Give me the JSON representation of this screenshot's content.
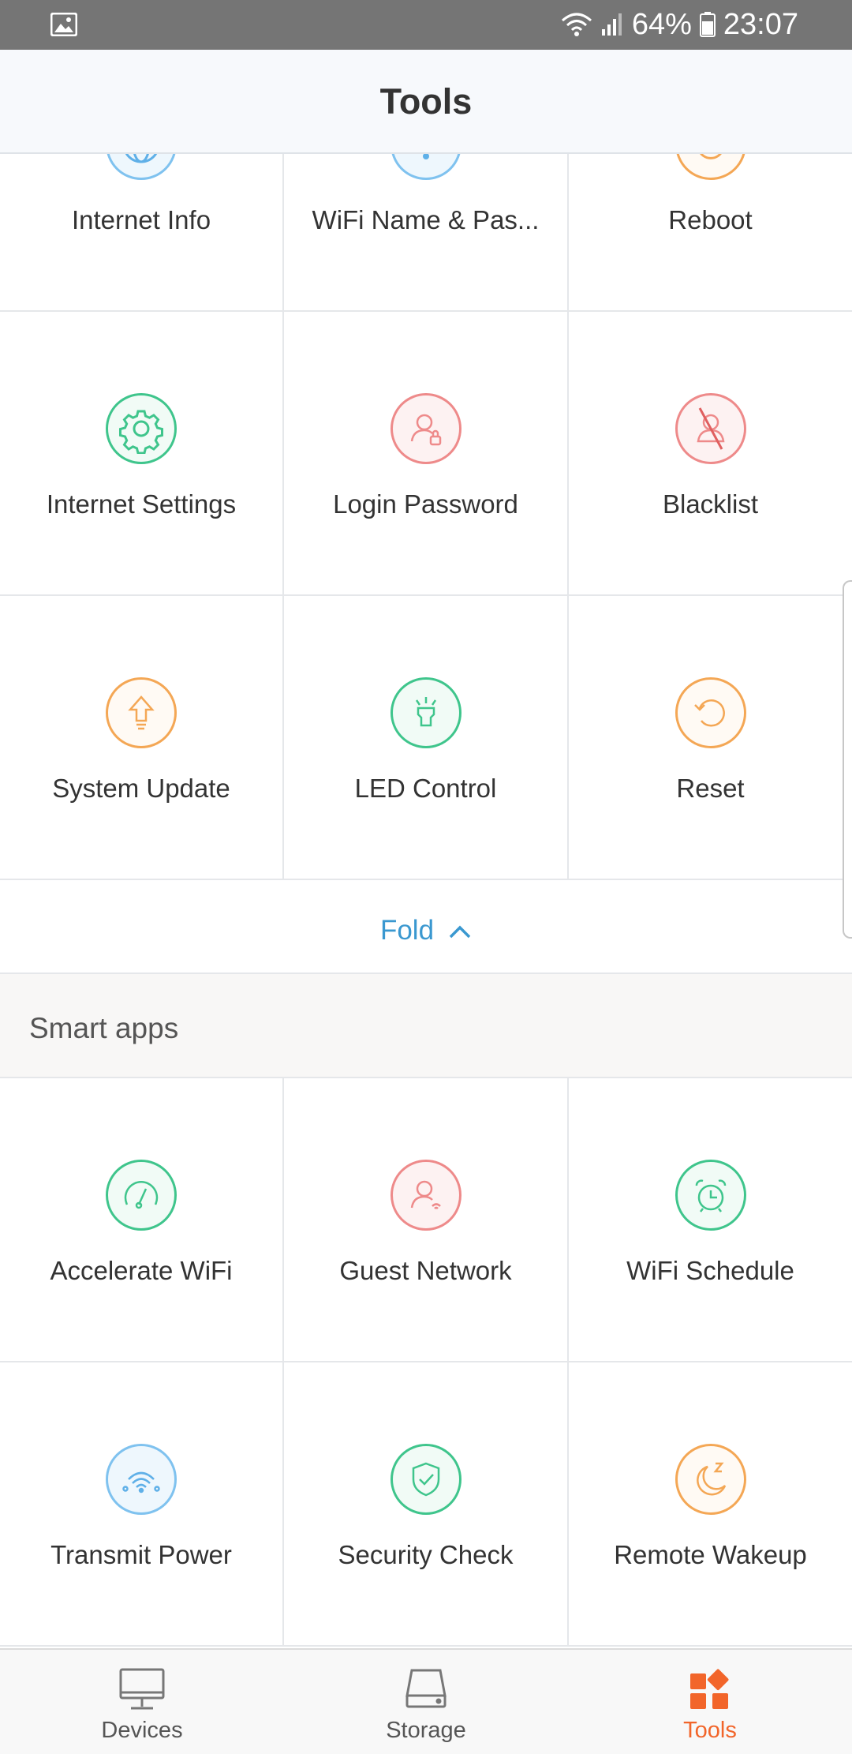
{
  "status_bar": {
    "battery": "64%",
    "time": "23:07"
  },
  "header": {
    "title": "Tools"
  },
  "tools_grid": [
    {
      "label": "Internet Info",
      "icon": "globe-icon",
      "color": "#7fc2ef"
    },
    {
      "label": "WiFi Name & Pas...",
      "icon": "wifi-key-icon",
      "color": "#7fc2ef"
    },
    {
      "label": "Reboot",
      "icon": "reboot-icon",
      "color": "#f4a755"
    },
    {
      "label": "Internet Settings",
      "icon": "gear-icon",
      "color": "#3fc58c"
    },
    {
      "label": "Login Password",
      "icon": "user-lock-icon",
      "color": "#ee8a8a"
    },
    {
      "label": "Blacklist",
      "icon": "user-blocked-icon",
      "color": "#ee8a8a"
    },
    {
      "label": "System Update",
      "icon": "upload-arrow-icon",
      "color": "#f4a755"
    },
    {
      "label": "LED Control",
      "icon": "led-icon",
      "color": "#3fc58c"
    },
    {
      "label": "Reset",
      "icon": "reset-icon",
      "color": "#f4a755"
    }
  ],
  "fold": {
    "label": "Fold"
  },
  "smart_apps": {
    "title": "Smart apps",
    "items": [
      {
        "label": "Accelerate WiFi",
        "icon": "speedometer-icon",
        "color": "#3fc58c"
      },
      {
        "label": "Guest Network",
        "icon": "guest-user-icon",
        "color": "#ee8a8a"
      },
      {
        "label": "WiFi Schedule",
        "icon": "alarm-clock-icon",
        "color": "#3fc58c"
      },
      {
        "label": "Transmit Power",
        "icon": "wifi-signal-icon",
        "color": "#7fc2ef"
      },
      {
        "label": "Security Check",
        "icon": "shield-check-icon",
        "color": "#3fc58c"
      },
      {
        "label": "Remote Wakeup",
        "icon": "moon-z-icon",
        "color": "#f4a755"
      }
    ]
  },
  "bottom_nav": [
    {
      "label": "Devices",
      "icon": "monitor-icon"
    },
    {
      "label": "Storage",
      "icon": "storage-drive-icon"
    },
    {
      "label": "Tools",
      "icon": "tools-grid-icon",
      "active": true
    }
  ],
  "accent_color": "#f2652a",
  "link_color": "#3a98d0"
}
